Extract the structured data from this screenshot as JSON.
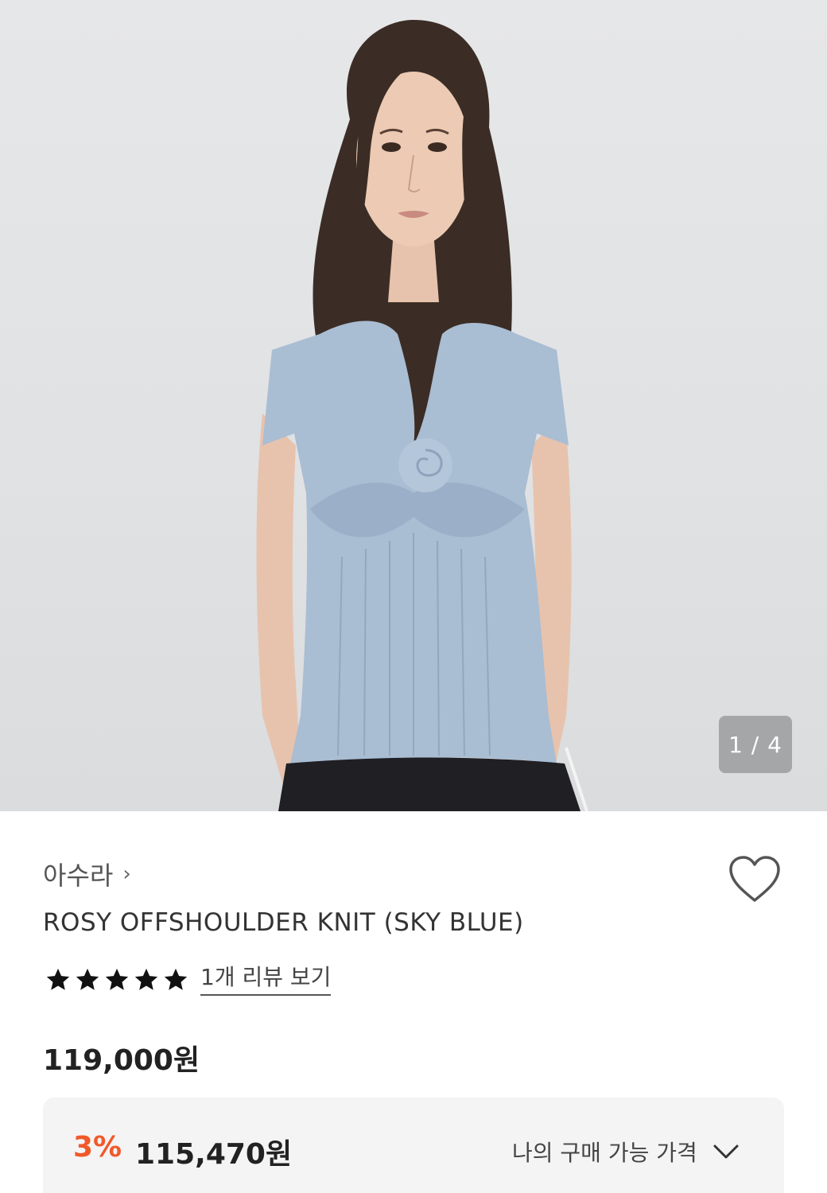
{
  "gallery": {
    "current_index": 1,
    "total": 4,
    "indicator_text": "1 / 4"
  },
  "product": {
    "brand": "아수라",
    "brand_chevron": "›",
    "title": "ROSY OFFSHOULDER KNIT (SKY BLUE)",
    "rating": 5,
    "rating_max": 5,
    "review_link": "1개 리뷰 보기",
    "price": "119,000원"
  },
  "discount": {
    "rate": "3%",
    "price": "115,470원",
    "my_price_label": "나의 구매 가능 가격"
  },
  "icons": {
    "wishlist": "heart-icon",
    "brand_arrow": "chevron-right-icon",
    "expand": "chevron-down-icon",
    "rating": "star-icon"
  },
  "colors": {
    "discount_accent": "#f0592a",
    "knit": "#a9bdd3"
  }
}
